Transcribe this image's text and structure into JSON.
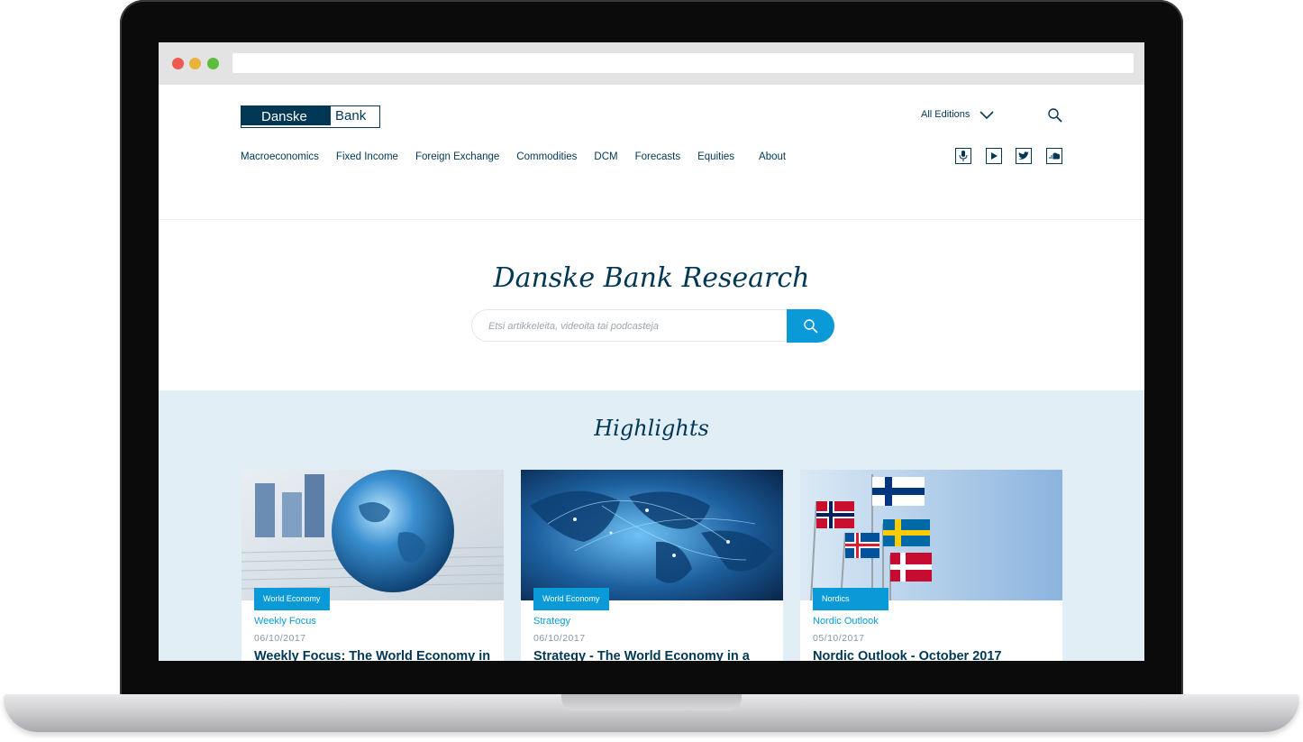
{
  "brand": {
    "logo_left": "Danske",
    "logo_right": "Bank",
    "color": "#003755",
    "accent": "#0b9ad8"
  },
  "header": {
    "editions_label": "All Editions",
    "nav": [
      "Macroeconomics",
      "Fixed Income",
      "Foreign Exchange",
      "Commodities",
      "DCM",
      "Forecasts",
      "Equities",
      "About"
    ],
    "social_icons": [
      "microphone-icon",
      "youtube-icon",
      "twitter-icon",
      "soundcloud-icon"
    ]
  },
  "hero": {
    "title": "Danske Bank Research",
    "search_placeholder": "Etsi artikkeleita, videoita tai podcasteja"
  },
  "highlights": {
    "title": "Highlights",
    "cards": [
      {
        "badge": "World Economy",
        "category": "Weekly Focus",
        "date": "06/10/2017",
        "title": "Weekly Focus: The World Economy in a sweet pot",
        "image": "glass-globe-on-financial-charts"
      },
      {
        "badge": "World Economy",
        "category": "Strategy",
        "date": "06/10/2017",
        "title": "Strategy - The World Economy in a sweet spot",
        "image": "digital-world-map"
      },
      {
        "badge": "Nordics",
        "category": "Nordic Outlook",
        "date": "05/10/2017",
        "title": "Nordic Outlook - October 2017",
        "image": "nordic-flags"
      }
    ]
  }
}
